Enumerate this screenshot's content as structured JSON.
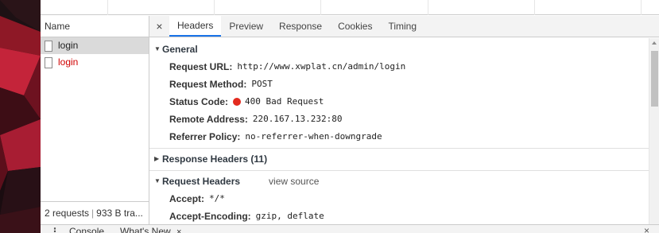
{
  "name_column": {
    "header": "Name",
    "requests": [
      {
        "name": "login",
        "state": "selected"
      },
      {
        "name": "login",
        "state": "error"
      }
    ],
    "summary": {
      "requests": "2 requests",
      "transferred": "933 B tra..."
    }
  },
  "details": {
    "close_glyph": "×",
    "tabs": [
      "Headers",
      "Preview",
      "Response",
      "Cookies",
      "Timing"
    ],
    "active_tab": "Headers",
    "general": {
      "title": "General",
      "fields": [
        {
          "key": "Request URL:",
          "value": "http://www.xwplat.cn/admin/login"
        },
        {
          "key": "Request Method:",
          "value": "POST"
        },
        {
          "key": "Status Code:",
          "value": "400 Bad Request",
          "status_color": "#e32b1f"
        },
        {
          "key": "Remote Address:",
          "value": "220.167.13.232:80"
        },
        {
          "key": "Referrer Policy:",
          "value": "no-referrer-when-downgrade"
        }
      ]
    },
    "response_headers": {
      "title": "Response Headers (11)"
    },
    "request_headers": {
      "title": "Request Headers",
      "view_source": "view source",
      "fields": [
        {
          "key": "Accept:",
          "value": "*/*"
        },
        {
          "key": "Accept-Encoding:",
          "value": "gzip, deflate"
        }
      ]
    }
  },
  "drawer": {
    "tabs": [
      {
        "label": "Console"
      },
      {
        "label": "What's New",
        "close": "×"
      }
    ],
    "close_glyph": "×"
  },
  "colors": {
    "active_tab_underline": "#1a73e8",
    "error_text": "#d00000",
    "status_dot": "#e32b1f",
    "selected_row": "#dadada"
  }
}
